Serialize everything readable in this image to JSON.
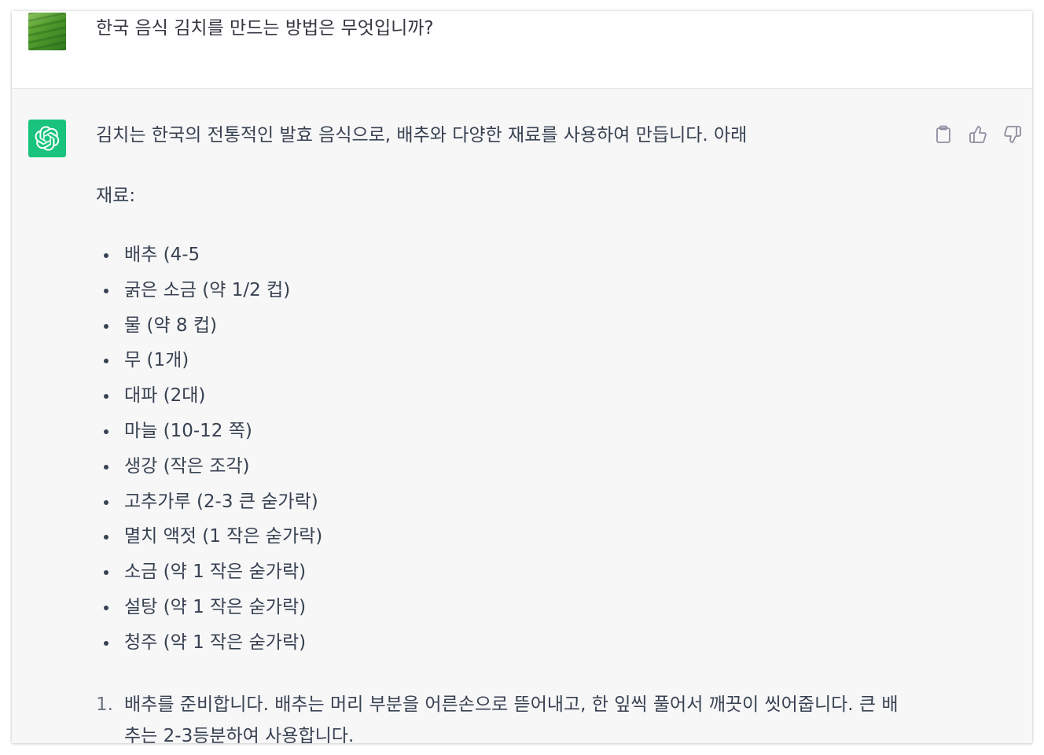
{
  "user_message": {
    "text": "한국 음식 김치를 만드는 방법은 무엇입니까?"
  },
  "assistant_message": {
    "intro": "김치는 한국의 전통적인 발효 음식으로, 배추와 다양한 재료를 사용하여 만듭니다. 아래",
    "ingredients_label": "재료:",
    "ingredients": [
      "배추 (4-5",
      "굵은 소금 (약 1/2 컵)",
      "물 (약 8 컵)",
      "무 (1개)",
      "대파 (2대)",
      "마늘 (10-12 쪽)",
      "생강 (작은 조각)",
      "고추가루 (2-3 큰 숟가락)",
      "멸치 액젓 (1 작은 숟가락)",
      "소금 (약 1 작은 숟가락)",
      "설탕 (약 1 작은 숟가락)",
      "청주 (약 1 작은 숟가락)"
    ],
    "steps": [
      {
        "number": "1.",
        "text": "배추를 준비합니다. 배추는 머리 부분을 어른손으로 뜯어내고, 한 잎씩 풀어서 깨끗이 씻어줍니다. 큰 배추는 2-3등분하여 사용합니다."
      }
    ]
  },
  "actions": {
    "copy_icon": "clipboard-icon",
    "like_icon": "thumbs-up-icon",
    "dislike_icon": "thumbs-down-icon"
  },
  "colors": {
    "assistant_bg": "#f7f7f8",
    "bot_avatar": "#19c37d",
    "text": "#374151",
    "icon": "#8e8ea0"
  }
}
